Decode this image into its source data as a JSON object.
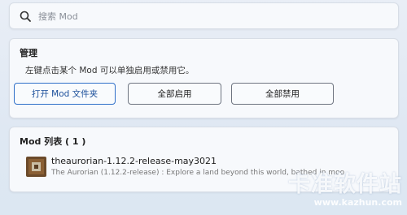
{
  "search": {
    "placeholder": "搜索 Mod"
  },
  "manage": {
    "title": "管理",
    "description": "左键点击某个 Mod 可以单独启用或禁用它。",
    "buttons": {
      "open_folder": "打开 Mod 文件夹",
      "enable_all": "全部启用",
      "disable_all": "全部禁用"
    }
  },
  "mod_list": {
    "title": "Mod 列表 ( 1 )",
    "items": [
      {
        "name": "theaurorian-1.12.2-release-may3021",
        "description": "The Aurorian (1.12.2-release) : Explore a land beyond this world, bathed in moo",
        "icon": "mod-block-icon"
      }
    ]
  },
  "watermark": {
    "text": "卡准软件站",
    "url": "www.kazhun.com"
  },
  "colors": {
    "accent": "#2f6fc9",
    "background": "#e4ecf5"
  }
}
